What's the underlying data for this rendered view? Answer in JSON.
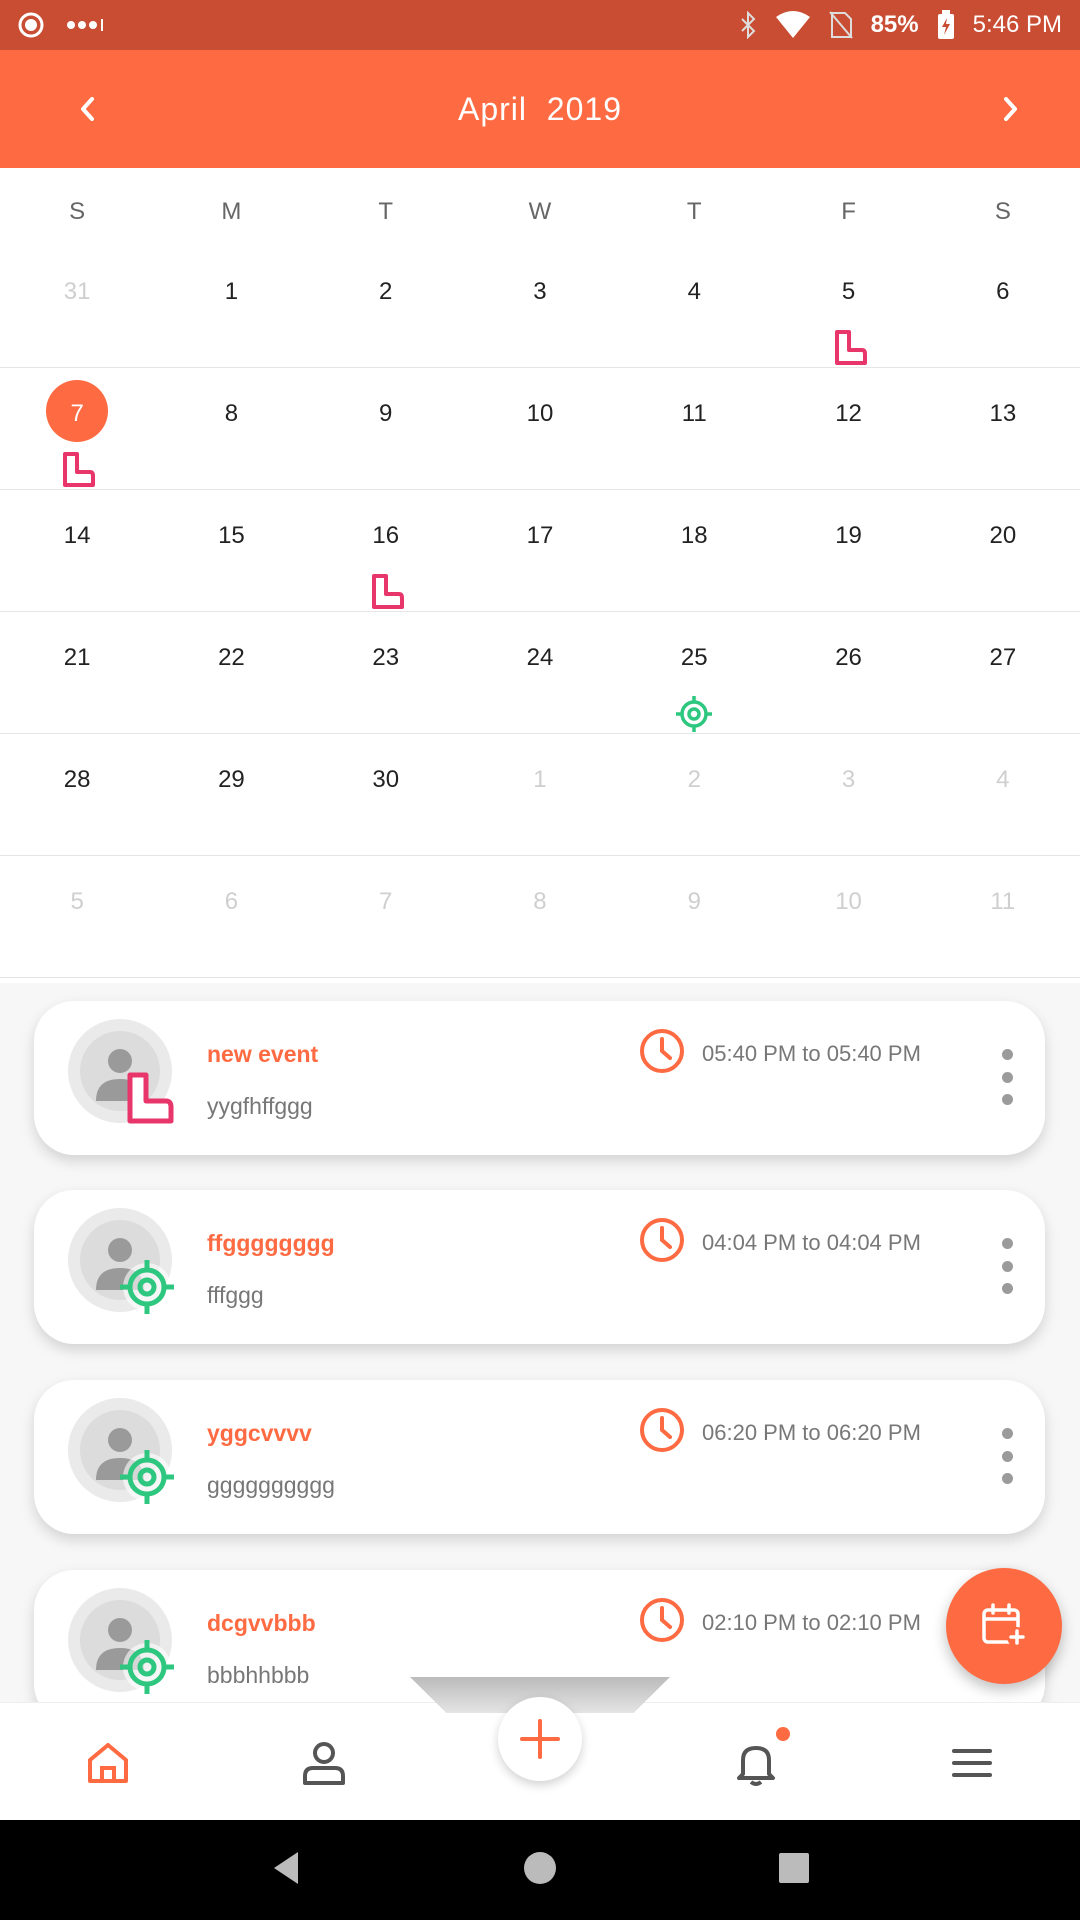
{
  "status_bar": {
    "battery": "85%",
    "time": "5:46 PM"
  },
  "header": {
    "title": "April  2019"
  },
  "weekdays": [
    "S",
    "M",
    "T",
    "W",
    "T",
    "F",
    "S"
  ],
  "calendar": {
    "weeks": [
      [
        "31",
        "1",
        "2",
        "3",
        "4",
        "5",
        "6"
      ],
      [
        "7",
        "8",
        "9",
        "10",
        "11",
        "12",
        "13"
      ],
      [
        "14",
        "15",
        "16",
        "17",
        "18",
        "19",
        "20"
      ],
      [
        "21",
        "22",
        "23",
        "24",
        "25",
        "26",
        "27"
      ],
      [
        "28",
        "29",
        "30",
        "1",
        "2",
        "3",
        "4"
      ],
      [
        "5",
        "6",
        "7",
        "8",
        "9",
        "10",
        "11"
      ]
    ],
    "selected_day": "7",
    "accent_color": "#fe6a41",
    "boot_icon_color": "#e8366a",
    "target_icon_color": "#2ec77f"
  },
  "events": [
    {
      "title": "new event",
      "subtitle": "yygfhffggg",
      "time": "05:40 PM to 05:40 PM",
      "icon": "boot-icon"
    },
    {
      "title": "ffgggggggg",
      "subtitle": "fffggg",
      "time": "04:04 PM to 04:04 PM",
      "icon": "target-icon"
    },
    {
      "title": "yggcvvvv",
      "subtitle": "gggggggggg",
      "time": "06:20 PM to 06:20 PM",
      "icon": "target-icon"
    },
    {
      "title": "dcgvvbbb",
      "subtitle": "bbbhhbbb",
      "time": "02:10 PM to 02:10 PM",
      "icon": "target-icon"
    }
  ]
}
